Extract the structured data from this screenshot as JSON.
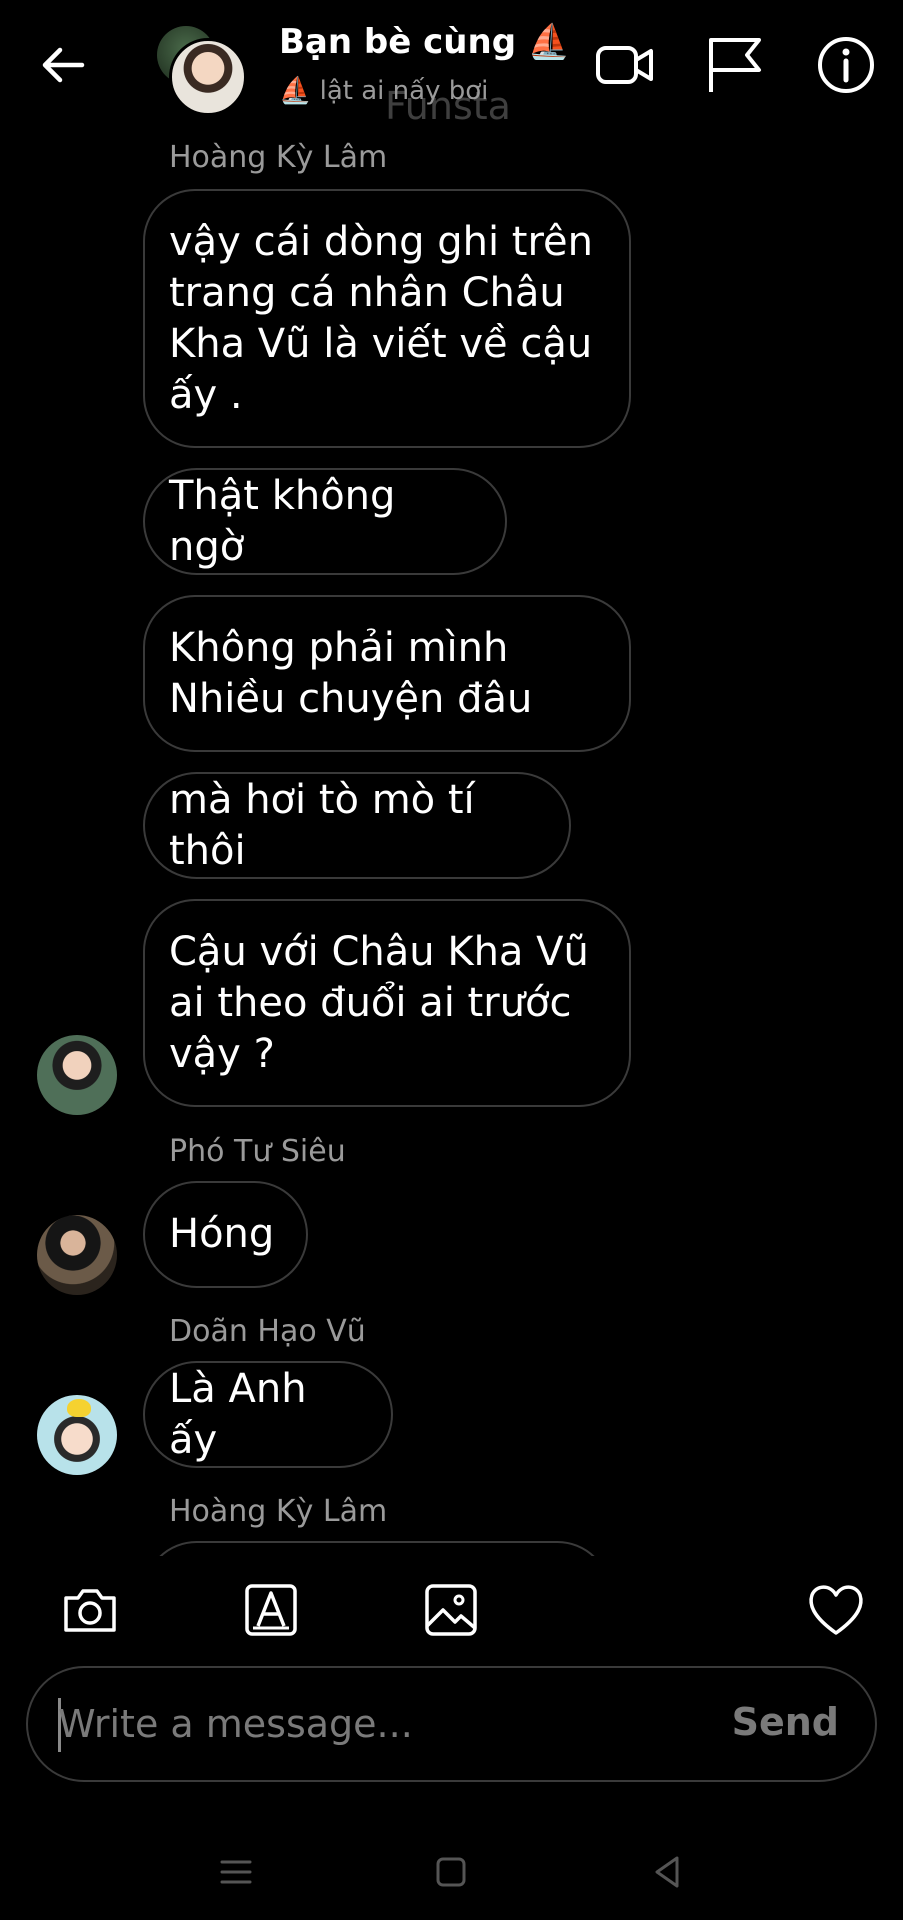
{
  "header": {
    "title": "Bạn bè cùng ⛵",
    "subtitle": "⛵ lật ai nấy bơi",
    "background_text": "Funsta"
  },
  "messages": [
    {
      "sender": "Hoàng Kỳ Lâm",
      "text": "vậy cái dòng ghi trên\ntrang cá nhân Châu\nKha Vũ  là viết  về cậu\nấy ."
    },
    {
      "text": "Thật không  ngờ"
    },
    {
      "text": "Không phải mình\nNhiều chuyện đâu"
    },
    {
      "text": "mà hơi tò mò tí thôi"
    },
    {
      "text": "Cậu với Châu Kha Vũ\nai theo đuổi ai trước\nvậy ?"
    },
    {
      "sender": "Phó Tư Siêu",
      "text": "Hóng"
    },
    {
      "sender": "Doãn Hạo Vũ",
      "text": "Là Anh ấy"
    },
    {
      "sender": "Hoàng Kỳ Lâm",
      "text": ""
    }
  ],
  "composer": {
    "value": "",
    "placeholder": "Write a message...",
    "send_label": "Send"
  },
  "icons": {
    "header": [
      "back-arrow-icon",
      "video-call-icon",
      "flag-icon",
      "info-icon"
    ],
    "toolbar": [
      "camera-icon",
      "sticker-icon",
      "gallery-icon",
      "heart-icon"
    ],
    "navbar": [
      "menu-icon",
      "home-icon",
      "back-icon"
    ]
  },
  "colors": {
    "background": "#000000",
    "bubble_border": "#3a3a3a",
    "secondary_text": "#9a9a9a"
  }
}
